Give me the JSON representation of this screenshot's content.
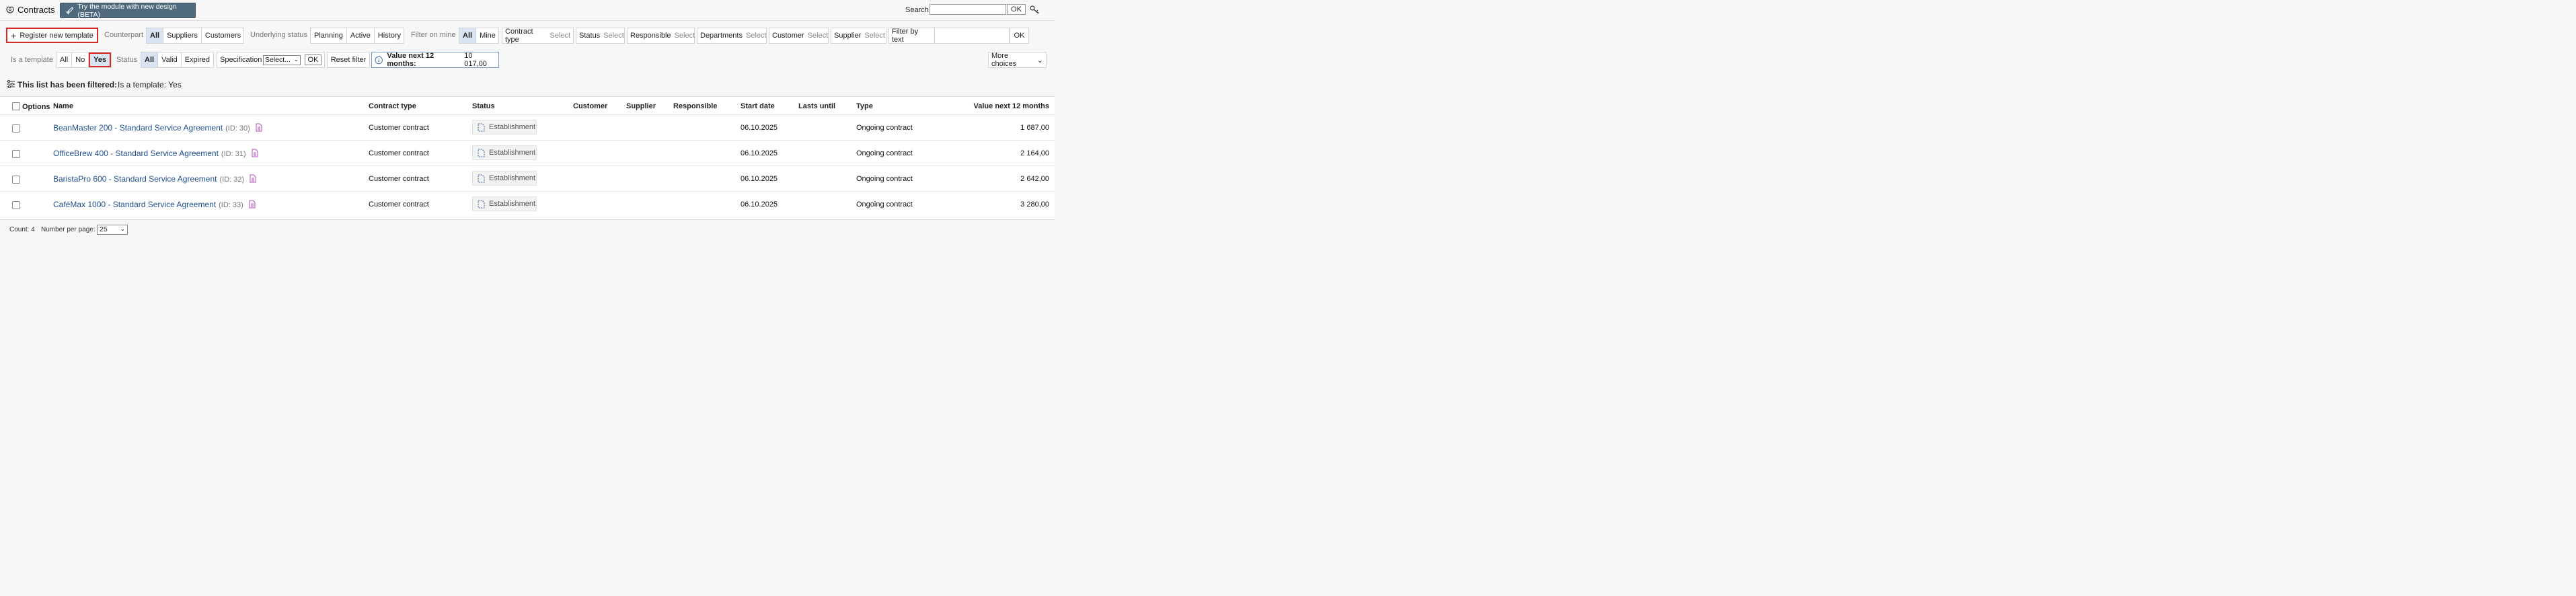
{
  "header": {
    "title": "Contracts",
    "beta_button": "Try the module with new design (BETA)",
    "search_label": "Search",
    "search_value": "",
    "search_ok": "OK",
    "icons": {
      "logo": "contracts-logo-icon",
      "rocket": "rocket-icon",
      "key": "key-icon"
    }
  },
  "row1": {
    "register_button": "Register new template",
    "counterpart_label": "Counterpart",
    "counterpart_options": [
      "All",
      "Suppliers",
      "Customers"
    ],
    "underlying_label": "Underlying status",
    "underlying_options": [
      "Planning",
      "Active",
      "History"
    ],
    "mine_label": "Filter on mine",
    "mine_options": [
      "All",
      "Mine"
    ],
    "contract_type": {
      "label": "Contract type",
      "value": "Select"
    },
    "status": {
      "label": "Status",
      "value": "Select"
    },
    "responsible": {
      "label": "Responsible",
      "value": "Select"
    },
    "departments": {
      "label": "Departments",
      "value": "Select"
    },
    "customer": {
      "label": "Customer",
      "value": "Select"
    },
    "supplier": {
      "label": "Supplier",
      "value": "Select"
    },
    "filter_text_label": "Filter by text",
    "filter_text_value": "",
    "filter_ok": "OK"
  },
  "row2": {
    "template_label": "Is a template",
    "template_options": [
      "All",
      "No",
      "Yes"
    ],
    "status_label": "Status",
    "status_options": [
      "All",
      "Valid",
      "Expired"
    ],
    "spec_label": "Specification",
    "spec_value": "Select...",
    "spec_ok": "OK",
    "reset_button": "Reset filter",
    "value_label": "Value next 12 months:",
    "value_amount": "10 017,00",
    "more_choices": "More choices"
  },
  "filtered": {
    "heading": "This list has been filtered:",
    "detail": "Is a template: Yes"
  },
  "table": {
    "headers": {
      "options": "Options",
      "name": "Name",
      "contract_type": "Contract type",
      "status": "Status",
      "customer": "Customer",
      "supplier": "Supplier",
      "responsible": "Responsible",
      "start_date": "Start date",
      "lasts_until": "Lasts until",
      "type": "Type",
      "value": "Value next 12 months"
    },
    "rows": [
      {
        "name": "BeanMaster 200 - Standard Service Agreement",
        "id": "(ID: 30)",
        "contract_type": "Customer contract",
        "status": "Establishment",
        "start_date": "06.10.2025",
        "type": "Ongoing contract",
        "value": "1 687,00"
      },
      {
        "name": "OfficeBrew 400 - Standard Service Agreement",
        "id": "(ID: 31)",
        "contract_type": "Customer contract",
        "status": "Establishment",
        "start_date": "06.10.2025",
        "type": "Ongoing contract",
        "value": "2 164,00"
      },
      {
        "name": "BaristaPro 600 - Standard Service Agreement",
        "id": "(ID: 32)",
        "contract_type": "Customer contract",
        "status": "Establishment",
        "start_date": "06.10.2025",
        "type": "Ongoing contract",
        "value": "2 642,00"
      },
      {
        "name": "CaféMax 1000 - Standard Service Agreement",
        "id": "(ID: 33)",
        "contract_type": "Customer contract",
        "status": "Establishment",
        "start_date": "06.10.2025",
        "type": "Ongoing contract",
        "value": "3 280,00"
      }
    ]
  },
  "footer": {
    "count": "Count: 4",
    "per_page_label": "Number per page:",
    "per_page_value": "25"
  },
  "colors": {
    "accent_selected": "#d9e4f2",
    "link": "#1f4e8f",
    "highlight_border": "#d62b2b",
    "beta_button": "#4f6a7d",
    "doc_icon": "#b052b8"
  }
}
